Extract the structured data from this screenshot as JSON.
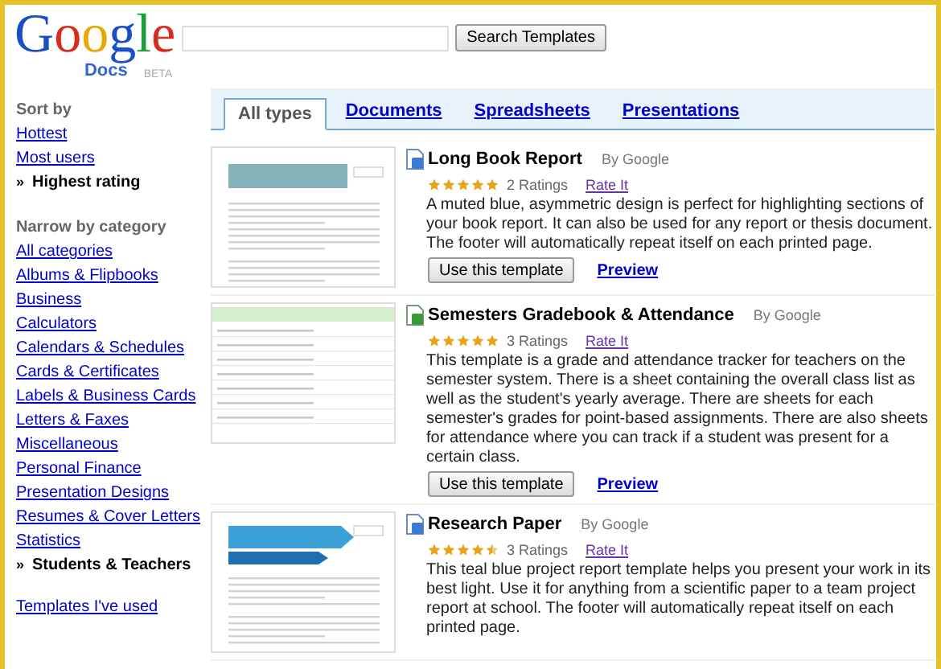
{
  "header": {
    "logo": {
      "word": "Google",
      "product": "Docs",
      "badge": "BETA"
    },
    "search_button": "Search Templates"
  },
  "sidebar": {
    "sort_heading": "Sort by",
    "sort_items": [
      {
        "label": "Hottest",
        "selected": false
      },
      {
        "label": "Most users",
        "selected": false
      },
      {
        "label": "Highest rating",
        "selected": true,
        "marker": "»"
      }
    ],
    "category_heading": "Narrow by category",
    "categories": [
      {
        "label": "All categories",
        "selected": false
      },
      {
        "label": "Albums & Flipbooks",
        "selected": false
      },
      {
        "label": "Business",
        "selected": false
      },
      {
        "label": "Calculators",
        "selected": false
      },
      {
        "label": "Calendars & Schedules",
        "selected": false
      },
      {
        "label": "Cards & Certificates",
        "selected": false
      },
      {
        "label": "Labels & Business Cards",
        "selected": false
      },
      {
        "label": "Letters & Faxes",
        "selected": false
      },
      {
        "label": "Miscellaneous",
        "selected": false
      },
      {
        "label": "Personal Finance",
        "selected": false
      },
      {
        "label": "Presentation Designs",
        "selected": false
      },
      {
        "label": "Resumes & Cover Letters",
        "selected": false
      },
      {
        "label": "Statistics",
        "selected": false
      },
      {
        "label": "Students & Teachers",
        "selected": true,
        "marker": "»"
      }
    ],
    "used_link": "Templates I've used"
  },
  "tabs": [
    {
      "label": "All types",
      "selected": true
    },
    {
      "label": "Documents",
      "selected": false
    },
    {
      "label": "Spreadsheets",
      "selected": false
    },
    {
      "label": "Presentations",
      "selected": false
    }
  ],
  "templates": [
    {
      "kind": "document",
      "title": "Long Book Report",
      "author": "By Google",
      "stars": 5,
      "ratings": "2 Ratings",
      "rate_link": "Rate It",
      "description": "A muted blue, asymmetric design is perfect for highlighting sections of your book report. It can also be used for any report or thesis document. The footer will automatically repeat itself on each printed page.",
      "use_button": "Use this template",
      "preview_link": "Preview"
    },
    {
      "kind": "spreadsheet",
      "title": "Semesters Gradebook & Attendance",
      "author": "By Google",
      "stars": 5,
      "ratings": "3 Ratings",
      "rate_link": "Rate It",
      "description": "This template is a grade and attendance tracker for teachers on the semester system. There is a sheet containing the overall class list as well as the student's yearly average. There are sheets for each semester's grades for point-based assignments. There are also sheets for attendance where you can track if a student was present for a certain class.",
      "use_button": "Use this template",
      "preview_link": "Preview"
    },
    {
      "kind": "document",
      "title": "Research Paper",
      "author": "By Google",
      "stars": 4.5,
      "ratings": "3 Ratings",
      "rate_link": "Rate It",
      "description": "This teal blue project report template helps you present your work in its best light. Use it for anything from a scientific paper to a team project report at school. The footer will automatically repeat itself on each printed page."
    }
  ]
}
